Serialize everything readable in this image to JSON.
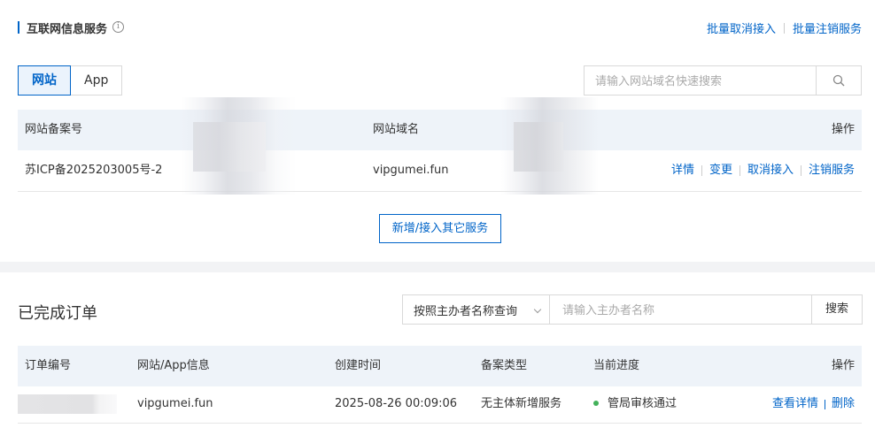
{
  "service_section": {
    "title": "互联网信息服务",
    "info_icon": "info-circle-icon",
    "links": [
      "批量取消接入",
      "批量注销服务"
    ]
  },
  "tabs": [
    {
      "label": "网站",
      "active": true
    },
    {
      "label": "App",
      "active": false
    }
  ],
  "search": {
    "placeholder": "请输入网站域名快速搜索",
    "icon": "search-icon"
  },
  "site_table": {
    "headers": {
      "record": "网站备案号",
      "domain": "网站域名",
      "ops": "操作"
    },
    "rows": [
      {
        "record": "苏ICP备2025203005号-2",
        "domain": "vipgumei.fun",
        "ops": [
          "详情",
          "变更",
          "取消接入",
          "注销服务"
        ]
      }
    ]
  },
  "add_button": "新增/接入其它服务",
  "orders_section": {
    "title": "已完成订单",
    "filter_select": "按照主办者名称查询",
    "filter_placeholder": "请输入主办者名称",
    "search_button": "搜索"
  },
  "orders_table": {
    "headers": {
      "order_no": "订单编号",
      "info": "网站/App信息",
      "created": "创建时间",
      "type": "备案类型",
      "progress": "当前进度",
      "ops": "操作"
    },
    "rows": [
      {
        "order_no": "",
        "info": "vipgumei.fun",
        "created": "2025-08-26 00:09:06",
        "type": "无主体新增服务",
        "progress": "管局审核通过",
        "ops": [
          "查看详情",
          "删除"
        ]
      }
    ]
  },
  "colors": {
    "accent": "#0064c8",
    "header_bg": "#eef3f9",
    "status_green": "#43b15a"
  }
}
